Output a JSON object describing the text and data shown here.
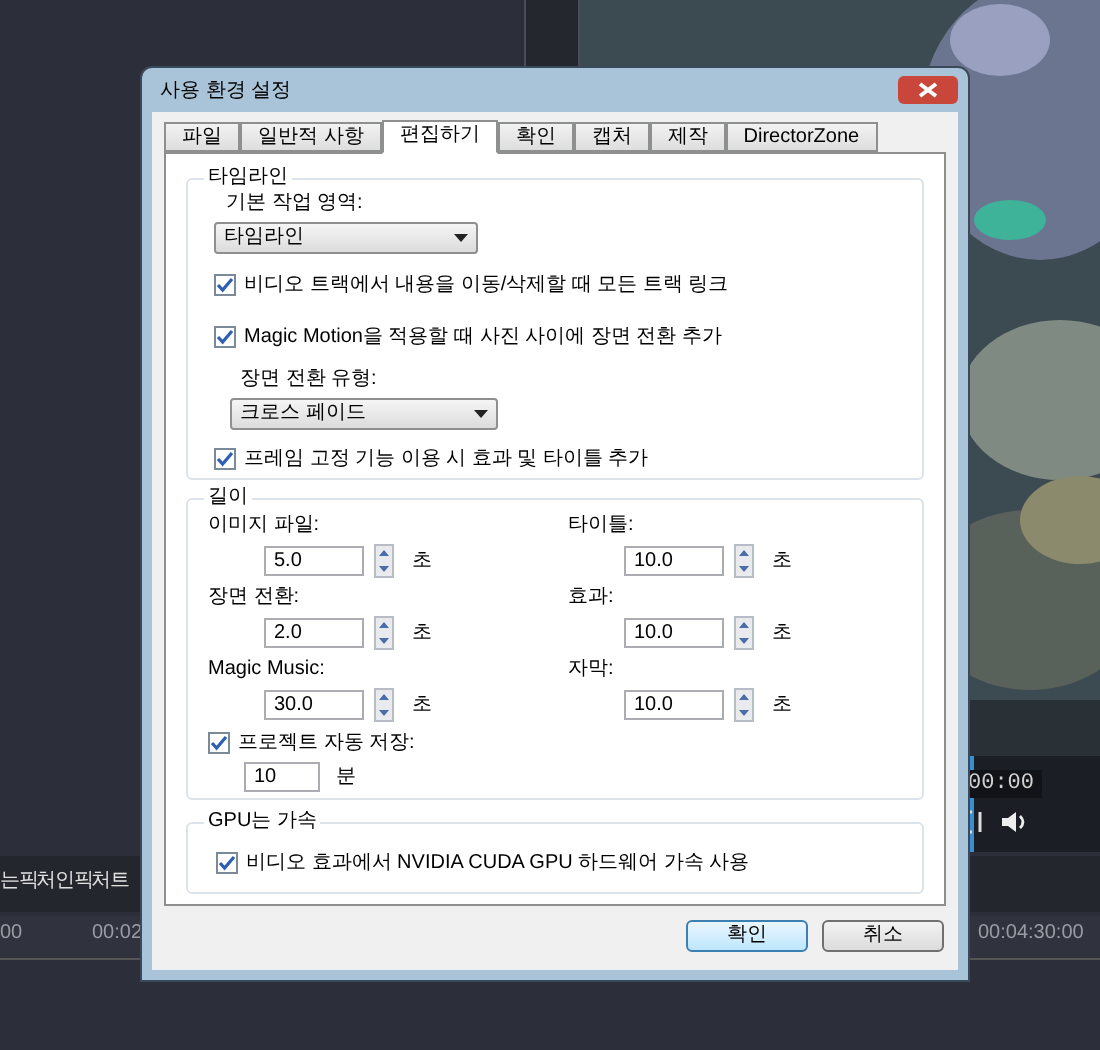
{
  "background": {
    "clip_title": "는 픽처 인 픽처 트",
    "ruler_labels": [
      "00",
      "00:02",
      "00:04:30:00"
    ],
    "timecode": "00:00"
  },
  "dialog": {
    "title": "사용 환경 설정",
    "tabs": [
      {
        "label": "파일",
        "selected": false
      },
      {
        "label": "일반적 사항",
        "selected": false
      },
      {
        "label": "편집하기",
        "selected": true
      },
      {
        "label": "확인",
        "selected": false
      },
      {
        "label": "캡처",
        "selected": false
      },
      {
        "label": "제작",
        "selected": false
      },
      {
        "label": "DirectorZone",
        "selected": false
      }
    ],
    "timeline_group": {
      "legend": "타임라인",
      "workspace_label": "기본 작업 영역:",
      "workspace_value": "타임라인",
      "link_tracks": {
        "label": "비디오 트랙에서 내용을 이동/삭제할 때 모든 트랙 링크",
        "checked": true
      },
      "magic_motion": {
        "label": "Magic Motion을 적용할 때 사진 사이에 장면 전환 추가",
        "checked": true
      },
      "transition_type_label": "장면 전환 유형:",
      "transition_type_value": "크로스 페이드",
      "freeze_frame": {
        "label": "프레임 고정 기능 이용 시 효과 및 타이틀 추가",
        "checked": true
      }
    },
    "duration_group": {
      "legend": "길이",
      "fields": [
        {
          "label": "이미지 파일:",
          "value": "5.0",
          "unit": "초"
        },
        {
          "label": "타이틀:",
          "value": "10.0",
          "unit": "초"
        },
        {
          "label": "장면 전환:",
          "value": "2.0",
          "unit": "초"
        },
        {
          "label": "효과:",
          "value": "10.0",
          "unit": "초"
        },
        {
          "label": "Magic Music:",
          "value": "30.0",
          "unit": "초"
        },
        {
          "label": "자막:",
          "value": "10.0",
          "unit": "초"
        }
      ],
      "autosave": {
        "label": "프로젝트 자동 저장:",
        "checked": true,
        "value": "10",
        "unit": "분"
      }
    },
    "gpu_group": {
      "legend": "GPU는 가속",
      "cuda": {
        "label": "비디오 효과에서 NVIDIA CUDA GPU 하드웨어 가속 사용",
        "checked": true
      }
    },
    "buttons": [
      {
        "label": "확인",
        "kind": "default"
      },
      {
        "label": "취소",
        "kind": "normal"
      }
    ]
  }
}
